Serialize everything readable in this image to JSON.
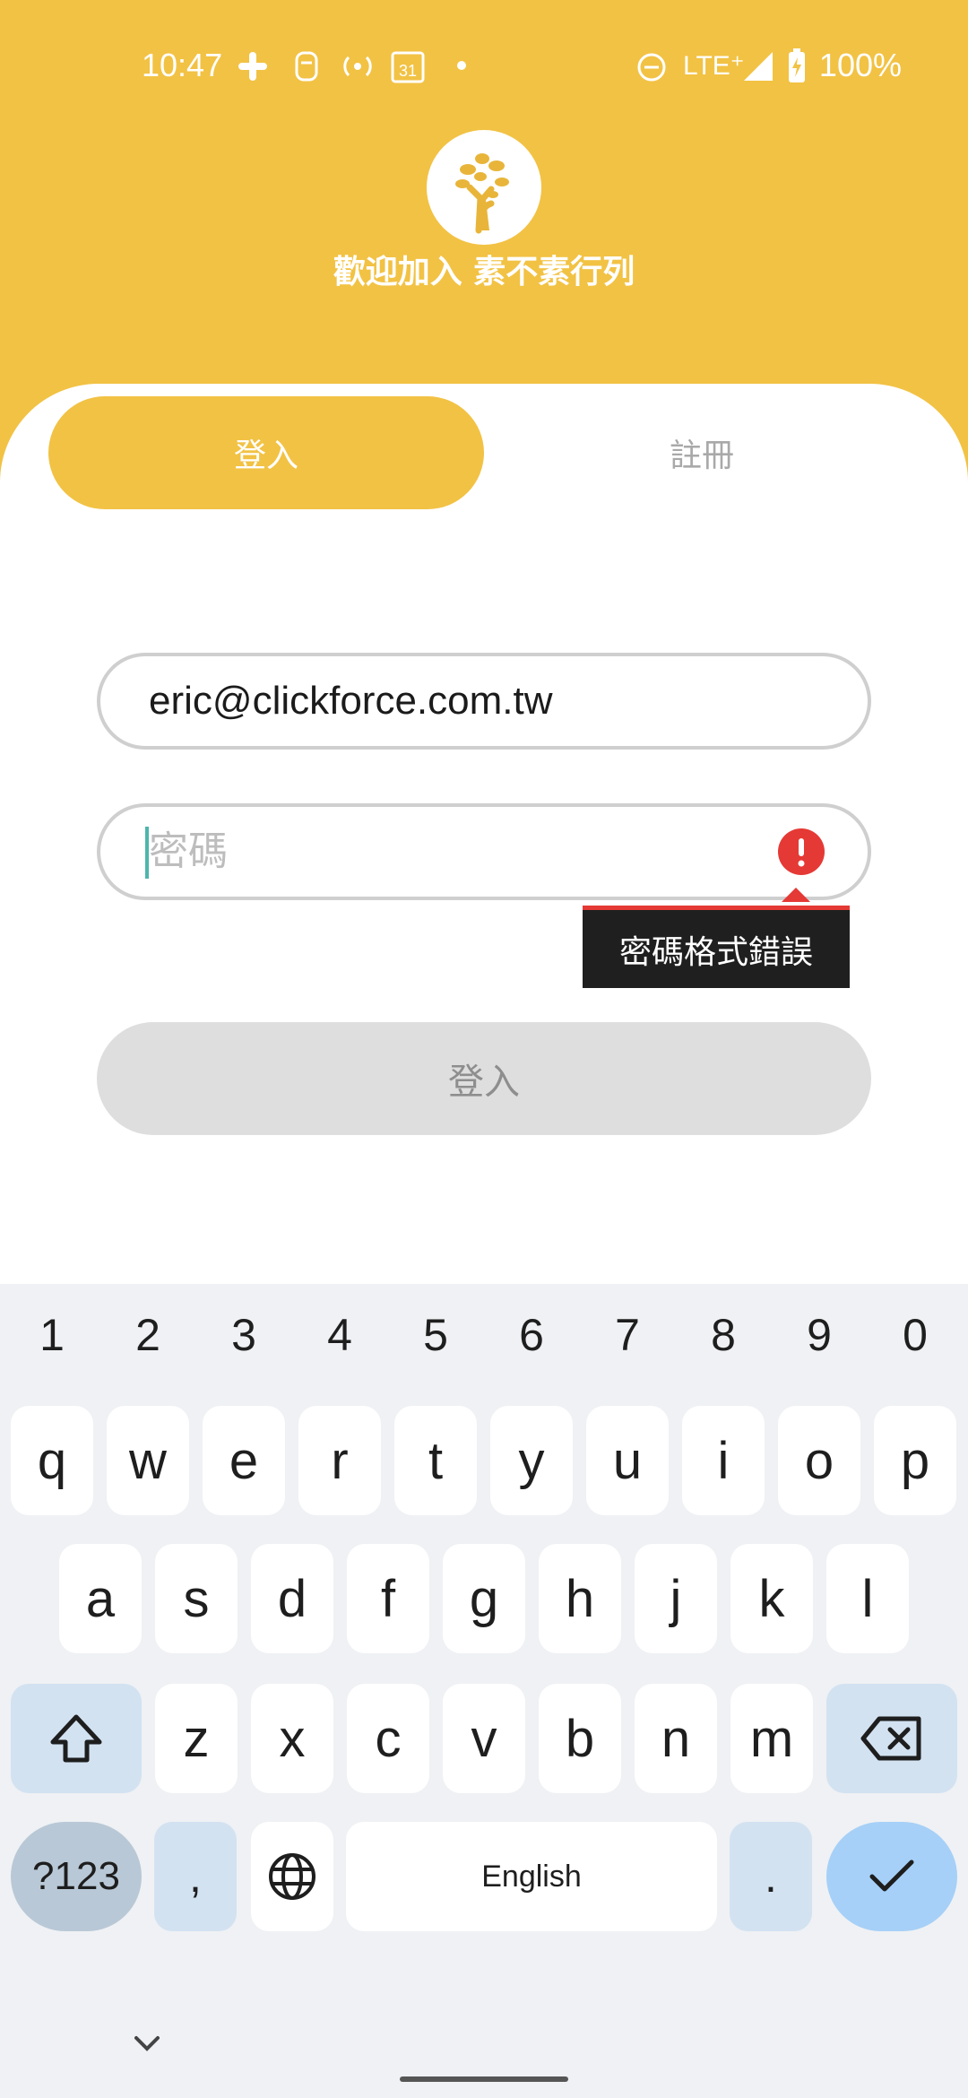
{
  "status_bar": {
    "time": "10:47",
    "network": "LTE⁺",
    "battery": "100%",
    "icons": [
      "slack-icon",
      "notification-icon",
      "hotspot-icon",
      "calendar-icon",
      "dot-icon",
      "do-not-disturb-icon",
      "signal-icon",
      "battery-charging-icon"
    ]
  },
  "header": {
    "logo_icon": "tree-icon",
    "welcome_text": "歡迎加入 素不素行列"
  },
  "tabs": [
    {
      "label": "登入",
      "selected": true
    },
    {
      "label": "註冊",
      "selected": false
    }
  ],
  "form": {
    "email_value": "eric@clickforce.com.tw",
    "password_placeholder": "密碼",
    "error_message": "密碼格式錯誤",
    "login_button": "登入"
  },
  "keyboard": {
    "numbers": [
      "1",
      "2",
      "3",
      "4",
      "5",
      "6",
      "7",
      "8",
      "9",
      "0"
    ],
    "row1": [
      "q",
      "w",
      "e",
      "r",
      "t",
      "y",
      "u",
      "i",
      "o",
      "p"
    ],
    "row2": [
      "a",
      "s",
      "d",
      "f",
      "g",
      "h",
      "j",
      "k",
      "l"
    ],
    "row3": [
      "z",
      "x",
      "c",
      "v",
      "b",
      "n",
      "m"
    ],
    "symbols_key": "?123",
    "comma_key": ",",
    "space_label": "English",
    "period_key": "."
  },
  "colors": {
    "brand": "#F2C244",
    "error": "#E53935",
    "disabled_button": "#dedede"
  }
}
